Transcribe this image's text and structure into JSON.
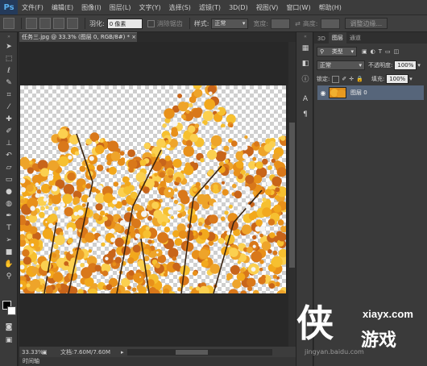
{
  "app": {
    "logo": "Ps"
  },
  "menu": [
    "文件(F)",
    "编辑(E)",
    "图像(I)",
    "图层(L)",
    "文字(Y)",
    "选择(S)",
    "滤镜(T)",
    "3D(D)",
    "视图(V)",
    "窗口(W)",
    "帮助(H)"
  ],
  "options": {
    "feather_label": "羽化:",
    "feather_value": "0 像素",
    "antialias_label": "消除锯齿",
    "style_label": "样式:",
    "style_value": "正常",
    "width_label": "宽度:",
    "height_label": "高度:",
    "refine_edge": "调整边缘..."
  },
  "document": {
    "tab_title": "任务三.jpg @ 33.3% (图层 0, RGB/8#) *",
    "tab_close": "×"
  },
  "status": {
    "zoom": "33.33%",
    "doc_info": "文档:7.60M/7.60M"
  },
  "timeline_label": "时间轴",
  "layers_panel": {
    "tabs": [
      "3D",
      "图层",
      "通道"
    ],
    "active_tab": "图层",
    "kind_label": "类型",
    "blend_mode": "正常",
    "opacity_label": "不透明度:",
    "opacity_value": "100%",
    "lock_label": "锁定:",
    "fill_label": "填充:",
    "fill_value": "100%",
    "layer_name": "图层 0"
  },
  "watermark": {
    "url": "xiayx.com",
    "big": "侠",
    "game": "游戏",
    "sub": "jingyan.baidu.com"
  },
  "colors": {
    "foreground": "#000000",
    "background": "#ffffff",
    "selection": "#56657a"
  },
  "icons": {
    "tools": [
      "move-icon",
      "marquee-icon",
      "lasso-icon",
      "quick-select-icon",
      "crop-icon",
      "eyedropper-icon",
      "healing-icon",
      "brush-icon",
      "clone-stamp-icon",
      "history-brush-icon",
      "eraser-icon",
      "gradient-icon",
      "blur-icon",
      "dodge-icon",
      "pen-icon",
      "type-icon",
      "path-select-icon",
      "shape-icon",
      "hand-icon",
      "zoom-icon"
    ]
  }
}
